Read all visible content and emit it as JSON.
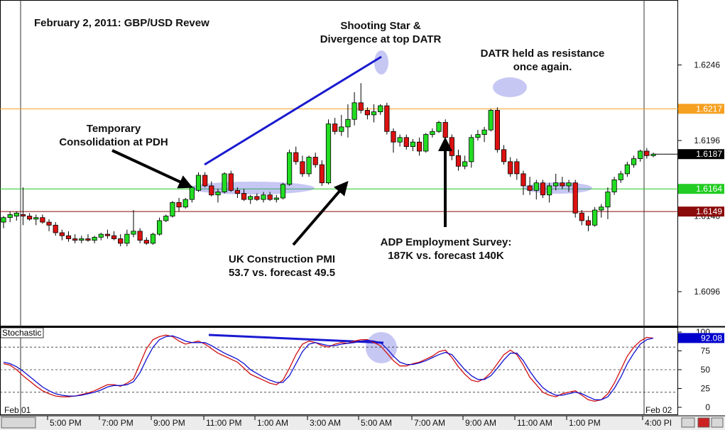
{
  "chart_data": [
    {
      "type": "candlestick",
      "title": "February 2, 2011: GBP/USD Revew",
      "price_ticks": [
        "1.6246",
        "1.6196",
        "1.6096"
      ],
      "price_ticks_values": [
        1.6246,
        1.6196,
        1.6096
      ],
      "ylim": [
        1.6073,
        1.6289
      ],
      "hlines": [
        {
          "value": 1.6217,
          "label": "1.6217",
          "color": "#f5a020"
        },
        {
          "value": 1.6164,
          "label": "1.6164",
          "color": "#22cc22"
        },
        {
          "value": 1.6149,
          "label": "1.6149",
          "color": "#8b0a0a"
        }
      ],
      "current_price": {
        "value": 1.6187,
        "label": "1.6187"
      },
      "partial_tick_label": "1.6146",
      "time_labels": [
        "Feb 01",
        "5:00 PM",
        "7:00 PM",
        "9:00 PM",
        "11:00 PM",
        "1:00 AM",
        "3:00 AM",
        "5:00 AM",
        "7:00 AM",
        "9:00 AM",
        "11:00 AM",
        "1:00 PM",
        "4:00 PI",
        "Feb 02"
      ],
      "bull_color": "#22dd22",
      "bear_color": "#dd1111",
      "candles": [
        [
          1.6142,
          1.6146,
          1.6138,
          1.6145
        ],
        [
          1.6145,
          1.6149,
          1.6142,
          1.6147
        ],
        [
          1.6146,
          1.6149,
          1.6143,
          1.6148
        ],
        [
          1.6147,
          1.6165,
          1.614,
          1.6146
        ],
        [
          1.6146,
          1.6148,
          1.6143,
          1.6144
        ],
        [
          1.6144,
          1.6147,
          1.614,
          1.6145
        ],
        [
          1.6145,
          1.6147,
          1.6141,
          1.6142
        ],
        [
          1.6142,
          1.6144,
          1.6136,
          1.614
        ],
        [
          1.614,
          1.6142,
          1.6133,
          1.6135
        ],
        [
          1.6135,
          1.6137,
          1.613,
          1.6133
        ],
        [
          1.6133,
          1.6136,
          1.6129,
          1.6131
        ],
        [
          1.6131,
          1.6134,
          1.6128,
          1.613
        ],
        [
          1.613,
          1.6133,
          1.6128,
          1.6131
        ],
        [
          1.6131,
          1.6134,
          1.6129,
          1.613
        ],
        [
          1.613,
          1.6133,
          1.6128,
          1.6132
        ],
        [
          1.6132,
          1.6135,
          1.613,
          1.6134
        ],
        [
          1.6134,
          1.6137,
          1.6131,
          1.6133
        ],
        [
          1.6133,
          1.6136,
          1.613,
          1.6131
        ],
        [
          1.6131,
          1.6134,
          1.6126,
          1.6128
        ],
        [
          1.6128,
          1.6137,
          1.6126,
          1.6134
        ],
        [
          1.6134,
          1.615,
          1.6132,
          1.6136
        ],
        [
          1.6136,
          1.6138,
          1.6128,
          1.613
        ],
        [
          1.613,
          1.6132,
          1.6127,
          1.6128
        ],
        [
          1.6128,
          1.6135,
          1.6127,
          1.6134
        ],
        [
          1.6134,
          1.6145,
          1.6133,
          1.6143
        ],
        [
          1.6143,
          1.6147,
          1.6142,
          1.6146
        ],
        [
          1.6146,
          1.6156,
          1.6145,
          1.6155
        ],
        [
          1.6155,
          1.6158,
          1.6149,
          1.6152
        ],
        [
          1.6152,
          1.6158,
          1.6151,
          1.6157
        ],
        [
          1.6157,
          1.6166,
          1.6155,
          1.6165
        ],
        [
          1.6163,
          1.6175,
          1.6162,
          1.6173
        ],
        [
          1.6173,
          1.6175,
          1.6165,
          1.6166
        ],
        [
          1.6166,
          1.6169,
          1.6159,
          1.616
        ],
        [
          1.616,
          1.6164,
          1.6155,
          1.6162
        ],
        [
          1.6162,
          1.6175,
          1.6161,
          1.6174
        ],
        [
          1.6174,
          1.6176,
          1.6162,
          1.6163
        ],
        [
          1.6163,
          1.6165,
          1.6158,
          1.6161
        ],
        [
          1.6161,
          1.6164,
          1.6156,
          1.6157
        ],
        [
          1.6157,
          1.616,
          1.6154,
          1.6159
        ],
        [
          1.6159,
          1.6161,
          1.6156,
          1.6157
        ],
        [
          1.6157,
          1.6162,
          1.6155,
          1.616
        ],
        [
          1.616,
          1.6162,
          1.6156,
          1.6157
        ],
        [
          1.6157,
          1.616,
          1.6155,
          1.6158
        ],
        [
          1.6158,
          1.6168,
          1.6157,
          1.6167
        ],
        [
          1.6167,
          1.619,
          1.6166,
          1.6188
        ],
        [
          1.6188,
          1.6192,
          1.618,
          1.6182
        ],
        [
          1.6182,
          1.6186,
          1.6172,
          1.6174
        ],
        [
          1.6174,
          1.6186,
          1.6172,
          1.6185
        ],
        [
          1.6185,
          1.6188,
          1.6178,
          1.618
        ],
        [
          1.618,
          1.6183,
          1.6166,
          1.6168
        ],
        [
          1.6168,
          1.621,
          1.6167,
          1.6207
        ],
        [
          1.6207,
          1.6211,
          1.62,
          1.6202
        ],
        [
          1.6202,
          1.6213,
          1.6199,
          1.6205
        ],
        [
          1.6205,
          1.622,
          1.6198,
          1.621
        ],
        [
          1.621,
          1.6228,
          1.6206,
          1.6221
        ],
        [
          1.6221,
          1.6234,
          1.6214,
          1.6216
        ],
        [
          1.6216,
          1.6218,
          1.621,
          1.6213
        ],
        [
          1.6213,
          1.622,
          1.6208,
          1.6215
        ],
        [
          1.6215,
          1.622,
          1.6213,
          1.6219
        ],
        [
          1.6219,
          1.6221,
          1.62,
          1.6202
        ],
        [
          1.6202,
          1.6204,
          1.6188,
          1.6195
        ],
        [
          1.6195,
          1.62,
          1.6192,
          1.6198
        ],
        [
          1.6198,
          1.62,
          1.619,
          1.6192
        ],
        [
          1.6192,
          1.6197,
          1.6189,
          1.6195
        ],
        [
          1.6195,
          1.6198,
          1.6186,
          1.6189
        ],
        [
          1.6189,
          1.6201,
          1.6188,
          1.62
        ],
        [
          1.62,
          1.6204,
          1.6198,
          1.6202
        ],
        [
          1.6202,
          1.6209,
          1.6201,
          1.6208
        ],
        [
          1.6208,
          1.621,
          1.6196,
          1.6198
        ],
        [
          1.6198,
          1.62,
          1.6183,
          1.6186
        ],
        [
          1.6186,
          1.619,
          1.6176,
          1.6179
        ],
        [
          1.6179,
          1.6186,
          1.6177,
          1.6182
        ],
        [
          1.6182,
          1.62,
          1.6178,
          1.6198
        ],
        [
          1.6198,
          1.6203,
          1.6196,
          1.62
        ],
        [
          1.62,
          1.6205,
          1.6195,
          1.6203
        ],
        [
          1.6203,
          1.6217,
          1.6202,
          1.6216
        ],
        [
          1.6216,
          1.6218,
          1.6188,
          1.619
        ],
        [
          1.619,
          1.6193,
          1.618,
          1.6182
        ],
        [
          1.6182,
          1.6185,
          1.6172,
          1.6174
        ],
        [
          1.6182,
          1.6184,
          1.617,
          1.6174
        ],
        [
          1.6174,
          1.6176,
          1.616,
          1.6166
        ],
        [
          1.6166,
          1.6172,
          1.616,
          1.6163
        ],
        [
          1.6163,
          1.617,
          1.6157,
          1.6168
        ],
        [
          1.6168,
          1.617,
          1.6158,
          1.616
        ],
        [
          1.616,
          1.6168,
          1.6155,
          1.6166
        ],
        [
          1.6166,
          1.6174,
          1.6163,
          1.6168
        ],
        [
          1.6168,
          1.6172,
          1.6164,
          1.6166
        ],
        [
          1.6166,
          1.617,
          1.6162,
          1.6168
        ],
        [
          1.6168,
          1.617,
          1.6145,
          1.6148
        ],
        [
          1.6148,
          1.615,
          1.614,
          1.6143
        ],
        [
          1.6143,
          1.6146,
          1.6136,
          1.614
        ],
        [
          1.614,
          1.6152,
          1.6139,
          1.615
        ],
        [
          1.615,
          1.6154,
          1.6145,
          1.6152
        ],
        [
          1.6152,
          1.6165,
          1.6144,
          1.6162
        ],
        [
          1.6162,
          1.6172,
          1.616,
          1.617
        ],
        [
          1.617,
          1.6176,
          1.6168,
          1.6174
        ],
        [
          1.6174,
          1.6182,
          1.6172,
          1.618
        ],
        [
          1.618,
          1.6186,
          1.6178,
          1.6184
        ],
        [
          1.6184,
          1.619,
          1.6182,
          1.6189
        ],
        [
          1.6189,
          1.6191,
          1.6184,
          1.6186
        ],
        [
          1.6186,
          1.6188,
          1.6185,
          1.6187
        ]
      ]
    },
    {
      "type": "line",
      "title": "Stochastic",
      "ylim": [
        0,
        100
      ],
      "y_ticks": [
        "100",
        "75",
        "50",
        "25",
        "0"
      ],
      "y_ticks_values": [
        100,
        75,
        50,
        25,
        0
      ],
      "dashed_levels": [
        80,
        50,
        20
      ],
      "current_value_label": "92.08",
      "series": [
        {
          "color": "#d01010",
          "values": [
            58,
            56,
            50,
            42,
            35,
            28,
            22,
            18,
            15,
            14,
            14,
            15,
            17,
            19,
            22,
            26,
            30,
            30,
            28,
            32,
            38,
            58,
            78,
            90,
            94,
            96,
            94,
            88,
            84,
            86,
            88,
            84,
            78,
            72,
            68,
            64,
            60,
            52,
            44,
            40,
            36,
            32,
            30,
            36,
            52,
            70,
            84,
            88,
            86,
            82,
            80,
            84,
            86,
            85,
            88,
            90,
            90,
            86,
            82,
            72,
            62,
            55,
            55,
            58,
            60,
            64,
            68,
            74,
            76,
            66,
            54,
            44,
            36,
            34,
            38,
            46,
            58,
            70,
            76,
            70,
            56,
            40,
            30,
            20,
            16,
            14,
            18,
            20,
            22,
            16,
            10,
            8,
            10,
            18,
            32,
            50,
            68,
            80,
            88,
            93,
            92
          ]
        },
        {
          "color": "#1010d0",
          "values": [
            60,
            58,
            54,
            48,
            41,
            34,
            27,
            22,
            18,
            16,
            15,
            15,
            16,
            18,
            20,
            23,
            27,
            29,
            29,
            30,
            34,
            46,
            64,
            80,
            90,
            94,
            95,
            92,
            88,
            86,
            86,
            86,
            82,
            77,
            72,
            68,
            64,
            58,
            50,
            45,
            40,
            36,
            33,
            33,
            42,
            58,
            74,
            84,
            86,
            84,
            82,
            82,
            84,
            85,
            86,
            88,
            89,
            88,
            86,
            78,
            68,
            60,
            57,
            57,
            59,
            62,
            66,
            70,
            73,
            70,
            60,
            50,
            42,
            37,
            37,
            42,
            52,
            63,
            72,
            72,
            62,
            48,
            36,
            26,
            20,
            16,
            16,
            18,
            20,
            18,
            14,
            10,
            10,
            14,
            25,
            40,
            58,
            72,
            84,
            90,
            92
          ]
        }
      ]
    }
  ],
  "annotations": {
    "consolidation": [
      "Temporary",
      "Consolidation at PDH"
    ],
    "shooting_star": [
      "Shooting Star &",
      "Divergence at top DATR"
    ],
    "datr_resistance": [
      "DATR held as resistance",
      "once again."
    ],
    "uk_pmi": [
      "UK Construction PMI",
      "53.7 vs. forecast 49.5"
    ],
    "adp": [
      "ADP Employment Survey:",
      "187K vs. forecast 140K"
    ]
  },
  "stochastic_label": "Stochastic"
}
